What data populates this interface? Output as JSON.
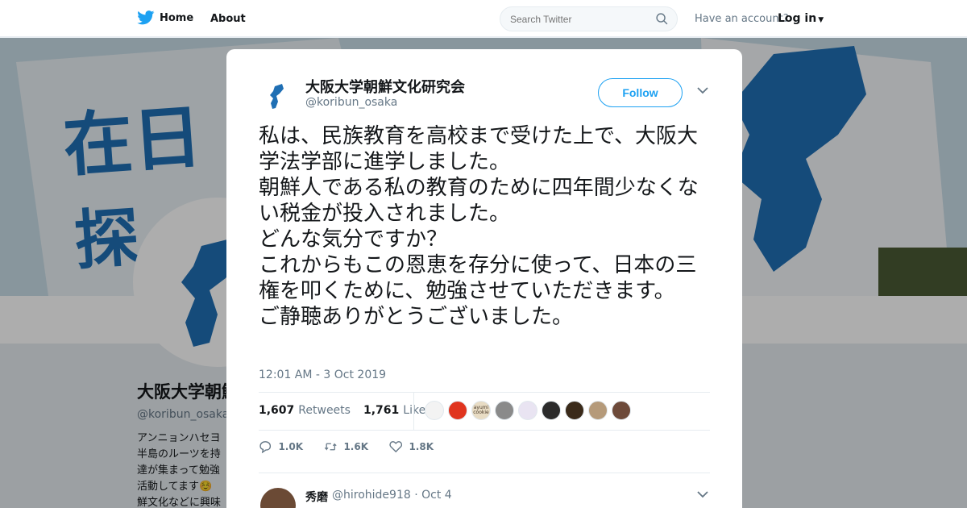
{
  "nav": {
    "home_label": "Home",
    "about_label": "About",
    "search_placeholder": "Search Twitter",
    "account_prompt": "Have an account?",
    "login_label": "Log in"
  },
  "banner": {
    "kanji_1": "在日",
    "kanji_2": "探"
  },
  "profile": {
    "name": "大阪大学朝鮮文化研究会",
    "handle": "@koribun_osaka",
    "bio_lines": [
      "アンニョンハセヨ",
      "半島のルーツを持",
      "達が集まって勉強",
      "活動してます☺️",
      "鮮文化などに興味"
    ]
  },
  "tweet": {
    "author_name": "大阪大学朝鮮文化研究会",
    "author_handle": "@koribun_osaka",
    "follow_label": "Follow",
    "text": "私は、民族教育を高校まで受けた上で、大阪大学法学部に進学しました。\n朝鮮人である私の教育のために四年間少なくない税金が投入されました。\nどんな気分ですか？\nこれからもこの恩恵を存分に使って、日本の三権を叩くために、勉強させていただきます。\nご静聴ありがとうございました。",
    "timestamp": "12:01 AM - 3 Oct 2019",
    "retweets_count": "1,607",
    "retweets_label": "Retweets",
    "likes_count": "1,761",
    "likes_label": "Likes",
    "liker_colors": [
      "#f3f3f3",
      "#e0341e",
      "#e8dcc4",
      "#8a8a8a",
      "#e9e4f2",
      "#2b2b2b",
      "#3a2a1a",
      "#b59a7a",
      "#6d4a3a"
    ],
    "liker_badge_text": "ayumi cookie",
    "reply_count": "1.0K",
    "retweet_action_count": "1.6K",
    "like_action_count": "1.8K"
  },
  "reply": {
    "name": "秀磨",
    "handle": "@hirohide918 · Oct 4"
  },
  "colors": {
    "brand": "#1da1f2",
    "text": "#14171a",
    "muted": "#657786",
    "korea_blue": "#1f6fb4"
  }
}
